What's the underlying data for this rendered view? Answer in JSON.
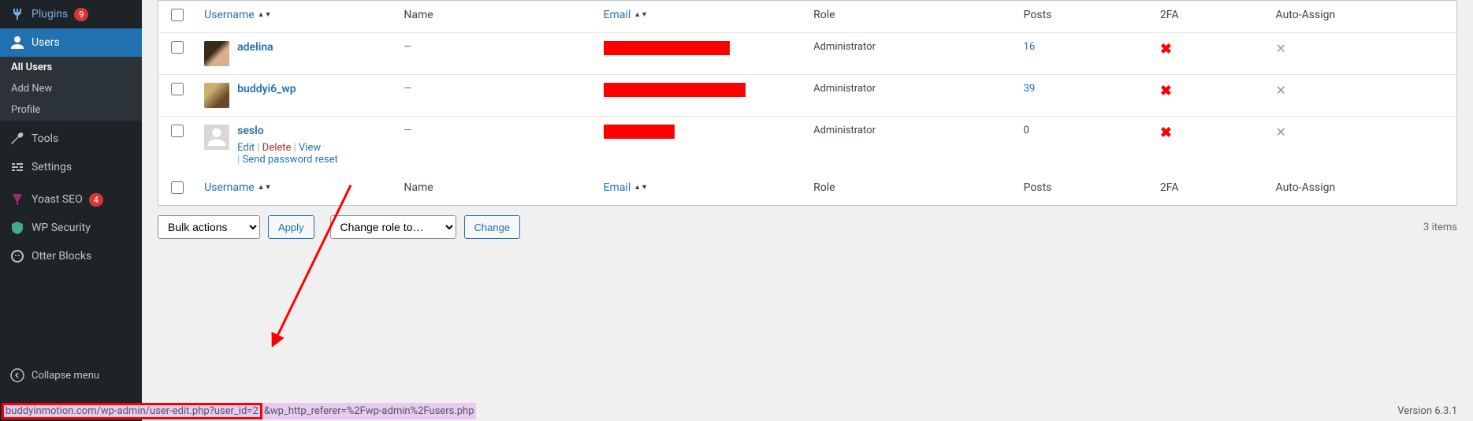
{
  "sidebar": {
    "plugins": {
      "label": "Plugins",
      "badge": "9"
    },
    "users": {
      "label": "Users"
    },
    "users_sub": {
      "all": "All Users",
      "add": "Add New",
      "profile": "Profile"
    },
    "tools": {
      "label": "Tools"
    },
    "settings": {
      "label": "Settings"
    },
    "yoast": {
      "label": "Yoast SEO",
      "badge": "4"
    },
    "wpsec": {
      "label": "WP Security"
    },
    "otter": {
      "label": "Otter Blocks"
    },
    "collapse": "Collapse menu"
  },
  "table": {
    "headers": {
      "username": "Username",
      "name": "Name",
      "email": "Email",
      "role": "Role",
      "posts": "Posts",
      "twofa": "2FA",
      "auto": "Auto-Assign"
    },
    "rows": [
      {
        "username": "adelina",
        "name": "—",
        "role": "Administrator",
        "posts": "16",
        "has2fa": false,
        "auto": false,
        "email_redact_w": 160,
        "avatar_class": "av-adelina"
      },
      {
        "username": "buddyi6_wp",
        "name": "—",
        "role": "Administrator",
        "posts": "39",
        "has2fa": false,
        "auto": false,
        "email_redact_w": 180,
        "avatar_class": "av-buddyi6"
      },
      {
        "username": "seslo",
        "name": "—",
        "role": "Administrator",
        "posts": "0",
        "has2fa": false,
        "auto": false,
        "email_redact_w": 90,
        "avatar_class": "placeholder",
        "hover": true
      }
    ],
    "row_actions": {
      "edit": "Edit",
      "delete": "Delete",
      "view": "View",
      "reset": "Send password reset"
    }
  },
  "tablenav": {
    "bulk_default": "Bulk actions",
    "apply": "Apply",
    "role_default": "Change role to…",
    "change": "Change",
    "items": "3 items"
  },
  "status": {
    "url_boxed": "buddyinmotion.com/wp-admin/user-edit.php?user_id=2",
    "url_rest": "&wp_http_referer=%2Fwp-admin%2Fusers.php",
    "version": "Version 6.3.1"
  }
}
